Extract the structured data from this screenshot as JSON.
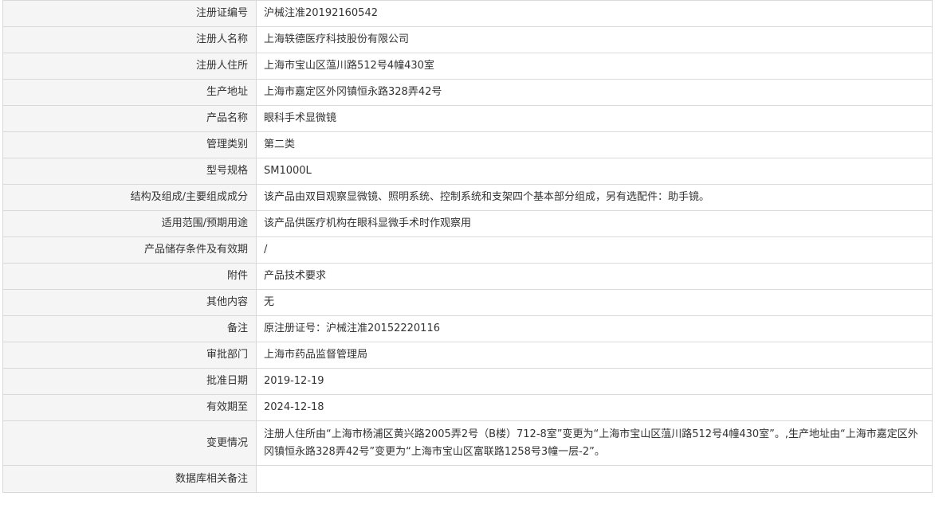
{
  "rows": [
    {
      "label": "注册证编号",
      "value": "沪械注准20192160542"
    },
    {
      "label": "注册人名称",
      "value": "上海轶德医疗科技股份有限公司"
    },
    {
      "label": "注册人住所",
      "value": "上海市宝山区蕰川路512号4幢430室"
    },
    {
      "label": "生产地址",
      "value": "上海市嘉定区外冈镇恒永路328弄42号"
    },
    {
      "label": "产品名称",
      "value": "眼科手术显微镜"
    },
    {
      "label": "管理类别",
      "value": "第二类"
    },
    {
      "label": "型号规格",
      "value": "SM1000L"
    },
    {
      "label": "结构及组成/主要组成成分",
      "value": "该产品由双目观察显微镜、照明系统、控制系统和支架四个基本部分组成，另有选配件：助手镜。"
    },
    {
      "label": "适用范围/预期用途",
      "value": "该产品供医疗机构在眼科显微手术时作观察用"
    },
    {
      "label": "产品储存条件及有效期",
      "value": "/"
    },
    {
      "label": "附件",
      "value": "产品技术要求"
    },
    {
      "label": "其他内容",
      "value": "无"
    },
    {
      "label": "备注",
      "value": "原注册证号：沪械注准20152220116"
    },
    {
      "label": "审批部门",
      "value": "上海市药品监督管理局"
    },
    {
      "label": "批准日期",
      "value": "2019-12-19"
    },
    {
      "label": "有效期至",
      "value": "2024-12-18"
    },
    {
      "label": "变更情况",
      "value": "注册人住所由“上海市杨浦区黄兴路2005弄2号（B楼）712-8室”变更为“上海市宝山区蕰川路512号4幢430室”。,生产地址由“上海市嘉定区外冈镇恒永路328弄42号”变更为“上海市宝山区富联路1258号3幢一层-2”。"
    },
    {
      "label": "数据库相关备注",
      "value": ""
    }
  ]
}
